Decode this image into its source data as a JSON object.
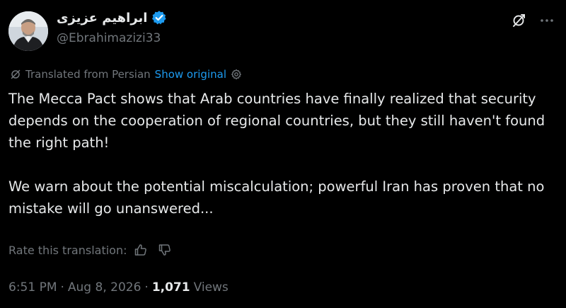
{
  "author": {
    "display_name": "ابراهیم عزیزی",
    "handle": "@Ebrahimazizi33",
    "verified_icon": "verified-badge-icon",
    "accent_color": "#1d9bf0"
  },
  "top_actions": {
    "grok_icon": "grok-icon",
    "more_icon": "more-horizontal-icon"
  },
  "translation": {
    "label": "Translated from Persian",
    "show_original": "Show original",
    "settings_icon": "settings-gear-icon",
    "translate_icon": "translate-icon"
  },
  "body": {
    "paragraph_1": "The Mecca Pact shows that Arab countries have finally realized that security depends on the cooperation of regional countries, but they still haven't found the right path!",
    "paragraph_2": "We warn about the potential miscalculation; powerful Iran has proven that no mistake will go unanswered..."
  },
  "rate": {
    "label": "Rate this translation:",
    "thumbs_up_icon": "thumbs-up-icon",
    "thumbs_down_icon": "thumbs-down-icon"
  },
  "meta": {
    "time": "6:51 PM",
    "separator": "·",
    "date": "Aug 8, 2026",
    "views_count": "1,071",
    "views_label": "Views"
  },
  "colors": {
    "background": "#000000",
    "text_primary": "#e7e9ea",
    "text_secondary": "#71767b",
    "link": "#1d9bf0"
  }
}
